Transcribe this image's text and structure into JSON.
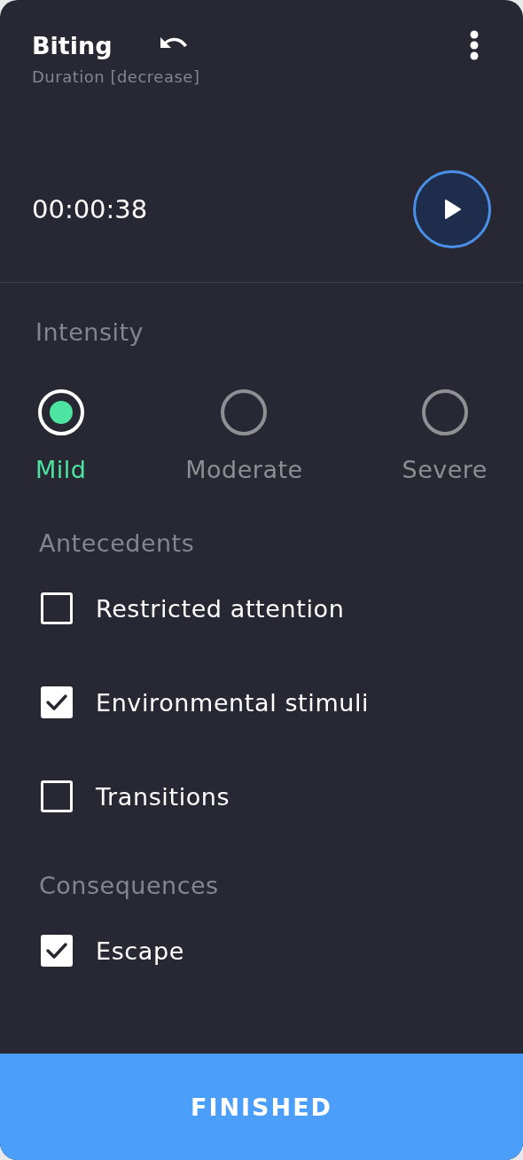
{
  "header": {
    "title": "Biting",
    "subtitle": "Duration [decrease]"
  },
  "timer": {
    "time": "00:00:38",
    "playing": false
  },
  "intensity": {
    "label": "Intensity",
    "options": [
      {
        "label": "Mild",
        "selected": true
      },
      {
        "label": "Moderate",
        "selected": false
      },
      {
        "label": "Severe",
        "selected": false
      }
    ]
  },
  "antecedents": {
    "label": "Antecedents",
    "items": [
      {
        "label": "Restricted attention",
        "checked": false
      },
      {
        "label": "Environmental stimuli",
        "checked": true
      },
      {
        "label": "Transitions",
        "checked": false
      }
    ]
  },
  "consequences": {
    "label": "Consequences",
    "items": [
      {
        "label": "Escape",
        "checked": true
      }
    ]
  },
  "button": {
    "label": "FINISHED"
  }
}
